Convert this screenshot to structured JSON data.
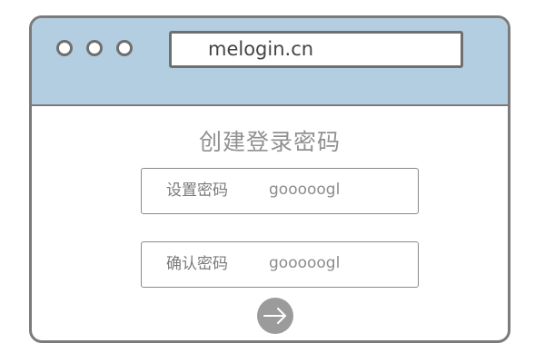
{
  "browser": {
    "address": "melogin.cn"
  },
  "page": {
    "title": "创建登录密码"
  },
  "form": {
    "set_password": {
      "label": "设置密码",
      "value": "gooooogl"
    },
    "confirm_password": {
      "label": "确认密码",
      "value": "gooooogl"
    },
    "submit_icon": "arrow-right-icon"
  },
  "colors": {
    "titlebar": "#b3cee0",
    "frame": "#7b7b7b",
    "button": "#9b9b9b"
  }
}
